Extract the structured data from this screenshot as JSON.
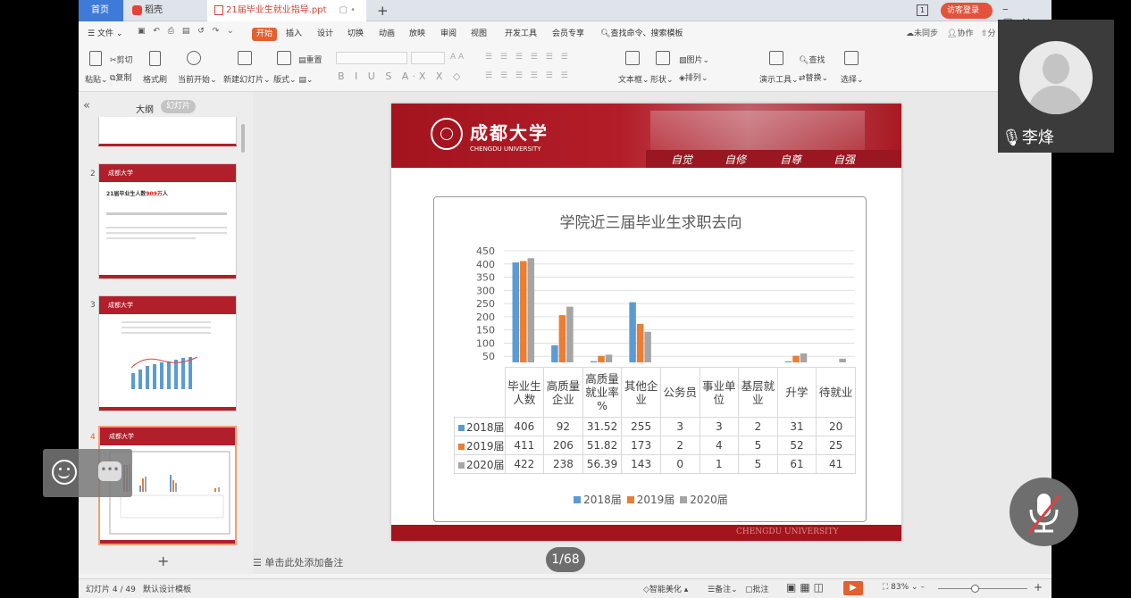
{
  "tabs": {
    "home": "首页",
    "wps": "稻壳",
    "doc": "21届毕业生就业指导.ppt",
    "login": "访客登录"
  },
  "menu": {
    "file": "文件",
    "start": "开始",
    "insert": "插入",
    "design": "设计",
    "switch": "切换",
    "anim": "动画",
    "play": "放映",
    "review": "审阅",
    "view": "视图",
    "dev": "开发工具",
    "vip": "会员专享",
    "search": "查找命令、搜索模板",
    "sync": "未同步",
    "collab": "协作",
    "share": "分"
  },
  "ribbon": {
    "paste": "粘贴",
    "cut": "剪切",
    "copy": "复制",
    "format": "格式刷",
    "from_current": "当前开始",
    "new_slide": "新建幻灯片",
    "layout": "版式",
    "reset": "重置",
    "textbox": "文本框",
    "shape": "形状",
    "arrange": "排列",
    "picture": "图片",
    "present_tools": "演示工具",
    "find": "查找",
    "replace": "替换",
    "select": "选择"
  },
  "sidebar": {
    "outline": "大纲",
    "slides": "幻灯片",
    "add": "+",
    "note": "单击此处添加备注",
    "thumbs": [
      {
        "num": "2",
        "title_a": "21届毕业生人数",
        "title_b": "909万",
        "title_c": "人"
      },
      {
        "num": "3"
      },
      {
        "num": "4"
      }
    ],
    "univ": "成都大学"
  },
  "slide": {
    "univ_cn": "成都大学",
    "univ_en": "CHENGDU UNIVERSITY",
    "mottos": [
      "自觉",
      "自修",
      "自尊",
      "自强"
    ],
    "footer": "CHENGDU UNIVERSITY"
  },
  "chart_data": {
    "type": "bar",
    "title": "学院近三届毕业生求职去向",
    "categories": [
      "毕业生人数",
      "高质量企业",
      "高质量就业率%",
      "其他企业",
      "公务员",
      "事业单位",
      "基层就业",
      "升学",
      "待就业"
    ],
    "category_lines": [
      [
        "毕业生",
        "人数"
      ],
      [
        "高质量",
        "企业"
      ],
      [
        "高质量",
        "就业率",
        "%"
      ],
      [
        "其他企",
        "业"
      ],
      [
        "公务员"
      ],
      [
        "事业单",
        "位"
      ],
      [
        "基层就",
        "业"
      ],
      [
        "升学"
      ],
      [
        "待就业"
      ]
    ],
    "ylim": [
      0,
      450
    ],
    "yticks": [
      0,
      50,
      100,
      150,
      200,
      250,
      300,
      350,
      400,
      450
    ],
    "grid": true,
    "legend": "bottom",
    "series": [
      {
        "name": "2018届",
        "color": "#5b9bd5",
        "values": [
          406,
          92,
          31.52,
          255,
          3,
          3,
          2,
          31,
          20
        ],
        "labels": [
          "406",
          "92",
          "31.52",
          "255",
          "3",
          "3",
          "2",
          "31",
          "20"
        ]
      },
      {
        "name": "2019届",
        "color": "#ed7d31",
        "values": [
          411,
          206,
          51.82,
          173,
          2,
          4,
          5,
          52,
          25
        ],
        "labels": [
          "411",
          "206",
          "51.82",
          "173",
          "2",
          "4",
          "5",
          "52",
          "25"
        ]
      },
      {
        "name": "2020届",
        "color": "#a5a5a5",
        "values": [
          422,
          238,
          56.39,
          143,
          0,
          1,
          5,
          61,
          41
        ],
        "labels": [
          "422",
          "238",
          "56.39",
          "143",
          "0",
          "1",
          "5",
          "61",
          "41"
        ]
      }
    ]
  },
  "page_counter": "1/68",
  "overlay": {
    "user": "李烽"
  },
  "status": {
    "slide_info": "幻灯片 4 / 49",
    "template": "默认设计模板",
    "beautify": "智能美化",
    "notes": "备注",
    "comment": "批注",
    "zoom": "83%"
  }
}
